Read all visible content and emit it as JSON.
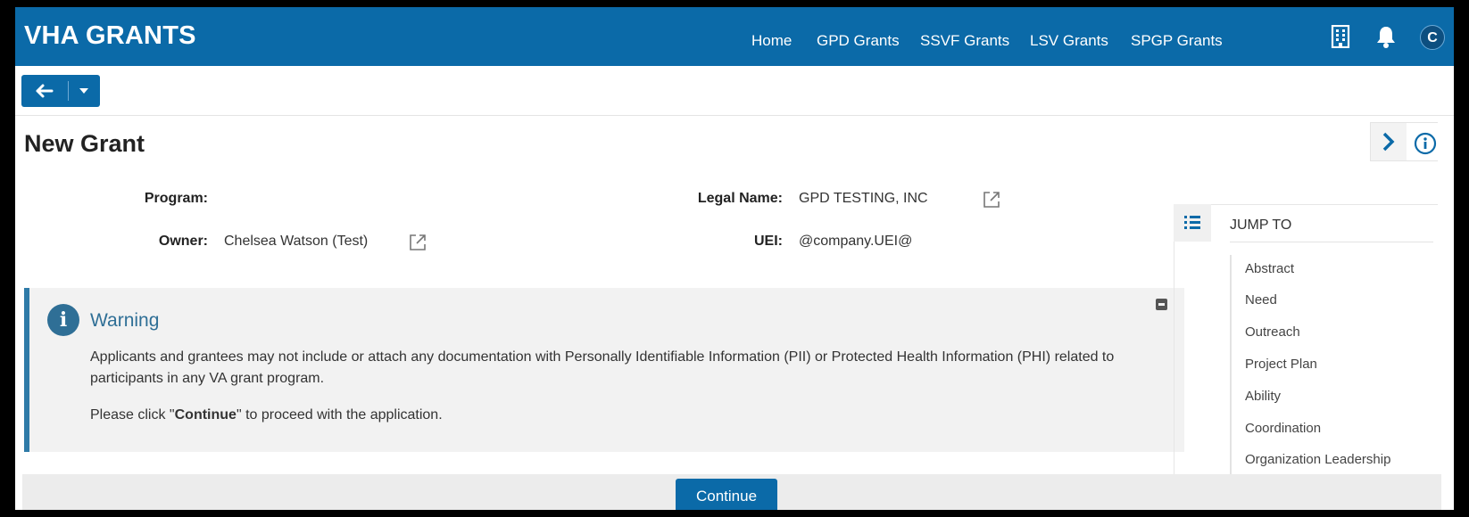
{
  "header": {
    "brand": "VHA GRANTS",
    "nav": [
      "Home",
      "GPD Grants",
      "SSVF Grants",
      "LSV Grants",
      "SPGP Grants"
    ],
    "avatar_initial": "C",
    "icons": [
      "building-icon",
      "bell-icon"
    ],
    "color": "#0b6aa8"
  },
  "toolbar": {
    "back_icon": "arrow-left-icon",
    "dropdown_icon": "caret-down-icon"
  },
  "page": {
    "title": "New Grant"
  },
  "fields": {
    "program_label": "Program:",
    "program_value": "",
    "owner_label": "Owner:",
    "owner_value": "Chelsea Watson (Test)",
    "legal_name_label": "Legal Name:",
    "legal_name_value": "GPD TESTING, INC",
    "uei_label": "UEI:",
    "uei_value": "@company.UEI@"
  },
  "warning": {
    "title": "Warning",
    "body": "Applicants and grantees may not include or attach any documentation with Personally Identifiable Information (PII) or Protected Health Information (PHI) related to participants in any VA grant program.",
    "cta_prefix": "Please click \"",
    "cta_bold": "Continue",
    "cta_suffix": "\" to proceed with the application."
  },
  "footer": {
    "continue_label": "Continue"
  },
  "jump_to": {
    "title": "JUMP TO",
    "items": [
      "Abstract",
      "Need",
      "Outreach",
      "Project Plan",
      "Ability",
      "Coordination",
      "Organization Leadership"
    ]
  }
}
